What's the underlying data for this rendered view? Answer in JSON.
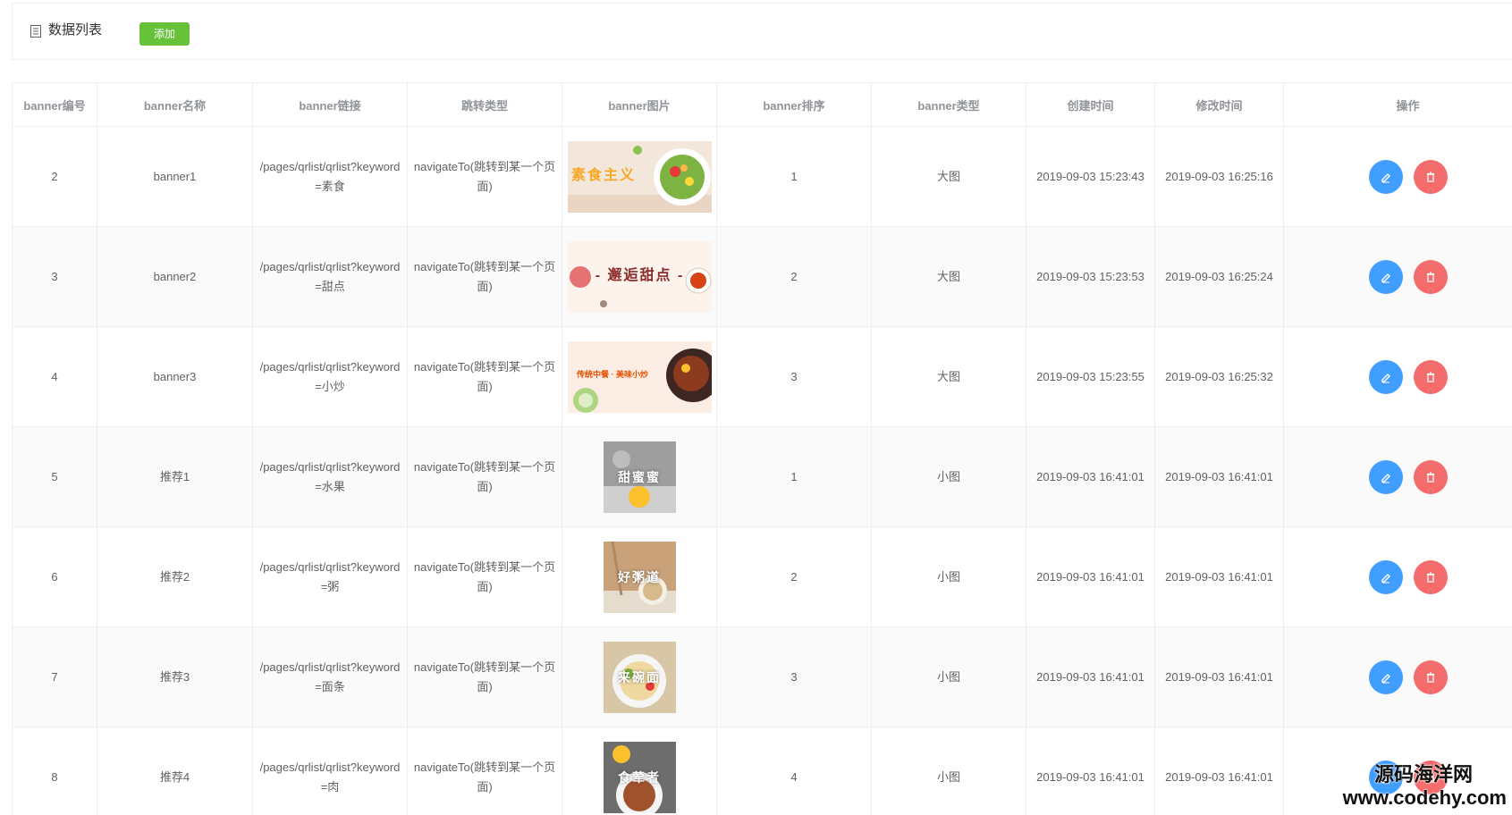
{
  "toolbar": {
    "title": "数据列表",
    "add_label": "添加",
    "list_icon": "list-icon"
  },
  "table": {
    "columns": [
      "banner编号",
      "banner名称",
      "banner链接",
      "跳转类型",
      "banner图片",
      "banner排序",
      "banner类型",
      "创建时间",
      "修改时间",
      "操作"
    ],
    "rows": [
      {
        "id": "2",
        "name": "banner1",
        "link": "/pages/qrlist/qrlist?keyword=素食",
        "jump": "navigateTo(跳转到某一个页面)",
        "image_caption": "素食主义",
        "order": "1",
        "type": "大图",
        "created": "2019-09-03 15:23:43",
        "modified": "2019-09-03 16:25:16"
      },
      {
        "id": "3",
        "name": "banner2",
        "link": "/pages/qrlist/qrlist?keyword=甜点",
        "jump": "navigateTo(跳转到某一个页面)",
        "image_caption": "- 邂逅甜点 -",
        "order": "2",
        "type": "大图",
        "created": "2019-09-03 15:23:53",
        "modified": "2019-09-03 16:25:24"
      },
      {
        "id": "4",
        "name": "banner3",
        "link": "/pages/qrlist/qrlist?keyword=小炒",
        "jump": "navigateTo(跳转到某一个页面)",
        "image_caption": "传统中餐 · 美味小炒",
        "order": "3",
        "type": "大图",
        "created": "2019-09-03 15:23:55",
        "modified": "2019-09-03 16:25:32"
      },
      {
        "id": "5",
        "name": "推荐1",
        "link": "/pages/qrlist/qrlist?keyword=水果",
        "jump": "navigateTo(跳转到某一个页面)",
        "image_caption": "甜蜜蜜",
        "order": "1",
        "type": "小图",
        "created": "2019-09-03 16:41:01",
        "modified": "2019-09-03 16:41:01"
      },
      {
        "id": "6",
        "name": "推荐2",
        "link": "/pages/qrlist/qrlist?keyword=粥",
        "jump": "navigateTo(跳转到某一个页面)",
        "image_caption": "好粥道",
        "order": "2",
        "type": "小图",
        "created": "2019-09-03 16:41:01",
        "modified": "2019-09-03 16:41:01"
      },
      {
        "id": "7",
        "name": "推荐3",
        "link": "/pages/qrlist/qrlist?keyword=面条",
        "jump": "navigateTo(跳转到某一个页面)",
        "image_caption": "来碗面",
        "order": "3",
        "type": "小图",
        "created": "2019-09-03 16:41:01",
        "modified": "2019-09-03 16:41:01"
      },
      {
        "id": "8",
        "name": "推荐4",
        "link": "/pages/qrlist/qrlist?keyword=肉",
        "jump": "navigateTo(跳转到某一个页面)",
        "image_caption": "食荤者",
        "order": "4",
        "type": "小图",
        "created": "2019-09-03 16:41:01",
        "modified": "2019-09-03 16:41:01"
      }
    ]
  },
  "watermark": {
    "line1": "源码海洋网",
    "line2": "www.codehy.com"
  },
  "colors": {
    "add": "#67c23a",
    "edit": "#409eff",
    "delete": "#f56c6c",
    "border": "#ebeef5"
  },
  "icons": {
    "edit": "edit-icon",
    "delete": "delete-icon"
  }
}
